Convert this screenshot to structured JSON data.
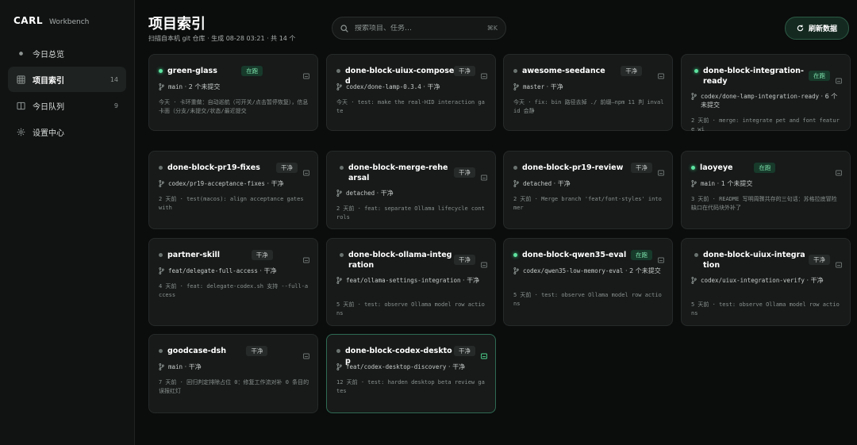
{
  "brand": {
    "name": "CARL",
    "sub": "Workbench"
  },
  "nav": [
    {
      "label": "今日总览",
      "count": "",
      "icon": "dot-icon",
      "active": false
    },
    {
      "label": "项目索引",
      "count": "14",
      "icon": "grid-icon",
      "active": true
    },
    {
      "label": "今日队列",
      "count": "9",
      "icon": "panel-icon",
      "active": false
    },
    {
      "label": "设置中心",
      "count": "",
      "icon": "gear-icon",
      "active": false
    }
  ],
  "header": {
    "title": "项目索引",
    "subtitle": "扫描自本机 git 仓库 · 生成 08-28 03:21 · 共 14 个"
  },
  "search": {
    "placeholder": "搜索项目、任务…",
    "shortcut": "⌘K"
  },
  "refresh": {
    "label": "刷新数据"
  },
  "colors": {
    "accent": "#5ee3a0",
    "card": "#171a19",
    "badge_running": "#173a2b"
  },
  "cards": [
    {
      "title": "green-glass",
      "badge": "在跑",
      "running": true,
      "branch": "main",
      "status": "2 个未提交",
      "commit": "今天 · 卡环重做：自动巡航（可开关/点击暂停恢复），信息卡面（分支/未提交/状态/最近提交"
    },
    {
      "title": "done-block-uiux-composed",
      "badge": "干净",
      "running": false,
      "branch": "codex/done-lamp-0.3.4",
      "status": "干净",
      "commit": "今天 · test: make the real-HID interaction gate"
    },
    {
      "title": "awesome-seedance",
      "badge": "干净",
      "running": false,
      "branch": "master",
      "status": "干净",
      "commit": "今天 · fix: bin 路径去掉 ./ 前缀—npm 11 判 invalid 会静"
    },
    {
      "title": "done-block-integration-ready",
      "badge": "在跑",
      "running": true,
      "branch": "codex/done-lamp-integration-ready",
      "status": "6 个未提交",
      "commit": "2 天前 · merge: integrate pet and font feature wi"
    },
    {
      "title": "done-block-pr19-fixes",
      "badge": "干净",
      "running": false,
      "branch": "codex/pr19-acceptance-fixes",
      "status": "干净",
      "commit": "2 天前 · test(macos): align acceptance gates with"
    },
    {
      "title": "done-block-merge-rehearsal",
      "badge": "干净",
      "running": false,
      "branch": "detached",
      "status": "干净",
      "commit": "2 天前 · feat: separate Ollama lifecycle controls"
    },
    {
      "title": "done-block-pr19-review",
      "badge": "干净",
      "running": false,
      "branch": "detached",
      "status": "干净",
      "commit": "2 天前 · Merge branch 'feat/font-styles' into mer"
    },
    {
      "title": "laoyeye",
      "badge": "在跑",
      "running": true,
      "branch": "main",
      "status": "1 个未提交",
      "commit": "3 天前 · README 写明周骤共存的三句话：苏格拉底冒险缺口在代码块外补了"
    },
    {
      "title": "partner-skill",
      "badge": "干净",
      "running": false,
      "branch": "feat/delegate-full-access",
      "status": "干净",
      "commit": "4 天前 · feat: delegate-codex.sh 支持 --full-access"
    },
    {
      "title": "done-block-ollama-integration",
      "badge": "干净",
      "running": false,
      "branch": "feat/ollama-settings-integration",
      "status": "干净",
      "commit": "5 天前 · test: observe Ollama model row actions"
    },
    {
      "title": "done-block-qwen35-eval",
      "badge": "在跑",
      "running": true,
      "branch": "codex/qwen35-low-memory-eval",
      "status": "2 个未提交",
      "commit": "5 天前 · test: observe Ollama model row actions"
    },
    {
      "title": "done-block-uiux-integration",
      "badge": "干净",
      "running": false,
      "branch": "codex/uiux-integration-verify",
      "status": "干净",
      "commit": "5 天前 · test: observe Ollama model row actions"
    },
    {
      "title": "goodcase-dsh",
      "badge": "干净",
      "running": false,
      "branch": "main",
      "status": "干净",
      "commit": "7 天前 · 回归判定排除占位 0：修复工作流对补 0 条目的误报红灯"
    },
    {
      "title": "done-block-codex-desktop",
      "badge": "干净",
      "running": false,
      "branch": "feat/codex-desktop-discovery",
      "status": "干净",
      "commit": "12 天前 · test: harden desktop beta review gates"
    }
  ]
}
